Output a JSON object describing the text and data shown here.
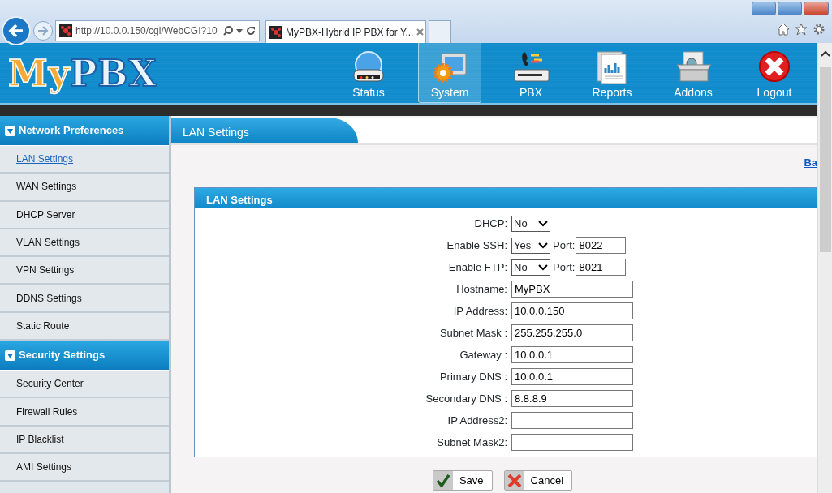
{
  "browser": {
    "address": "http://10.0.0.150/cgi/WebCGI?10",
    "tab_title": "MyPBX-Hybrid IP PBX for Y..."
  },
  "header": {
    "logo": "MyPBX",
    "nav": [
      {
        "label": "Status",
        "kind": "status",
        "selected": false
      },
      {
        "label": "System",
        "kind": "system",
        "selected": true
      },
      {
        "label": "PBX",
        "kind": "pbx",
        "selected": false
      },
      {
        "label": "Reports",
        "kind": "reports",
        "selected": false
      },
      {
        "label": "Addons",
        "kind": "addons",
        "selected": false
      },
      {
        "label": "Logout",
        "kind": "logout",
        "selected": false
      }
    ]
  },
  "sidebar": {
    "groups": [
      {
        "title": "Network Preferences",
        "items": [
          {
            "label": "LAN Settings",
            "selected": true
          },
          {
            "label": "WAN Settings",
            "selected": false
          },
          {
            "label": "DHCP Server",
            "selected": false
          },
          {
            "label": "VLAN Settings",
            "selected": false
          },
          {
            "label": "VPN Settings",
            "selected": false
          },
          {
            "label": "DDNS Settings",
            "selected": false
          },
          {
            "label": "Static Route",
            "selected": false
          }
        ]
      },
      {
        "title": "Security Settings",
        "items": [
          {
            "label": "Security Center",
            "selected": false
          },
          {
            "label": "Firewall Rules",
            "selected": false
          },
          {
            "label": "IP Blacklist",
            "selected": false
          },
          {
            "label": "AMI Settings",
            "selected": false
          }
        ]
      }
    ]
  },
  "page": {
    "title": "LAN Settings",
    "link": "Ba",
    "panel": {
      "title": "LAN Settings",
      "fields": [
        {
          "label": "DHCP:",
          "kind": "select",
          "value": "No"
        },
        {
          "label": "Enable SSH:",
          "kind": "select-port",
          "value": "Yes",
          "port_label": "Port:",
          "port": "8022"
        },
        {
          "label": "Enable FTP:",
          "kind": "select-port",
          "value": "No",
          "port_label": "Port:",
          "port": "8021"
        },
        {
          "label": "Hostname:",
          "kind": "text",
          "value": "MyPBX"
        },
        {
          "label": "IP Address:",
          "kind": "text",
          "value": "10.0.0.150"
        },
        {
          "label": "Subnet Mask :",
          "kind": "text",
          "value": "255.255.255.0"
        },
        {
          "label": "Gateway :",
          "kind": "text",
          "value": "10.0.0.1"
        },
        {
          "label": "Primary DNS :",
          "kind": "text",
          "value": "10.0.0.1"
        },
        {
          "label": "Secondary DNS :",
          "kind": "text",
          "value": "8.8.8.9"
        },
        {
          "label": "IP Address2:",
          "kind": "text"
        },
        {
          "label": "Subnet Mask2:",
          "kind": "text"
        }
      ]
    },
    "buttons": [
      {
        "label": "Save",
        "kind": "save"
      },
      {
        "label": "Cancel",
        "kind": "cancel"
      }
    ]
  }
}
